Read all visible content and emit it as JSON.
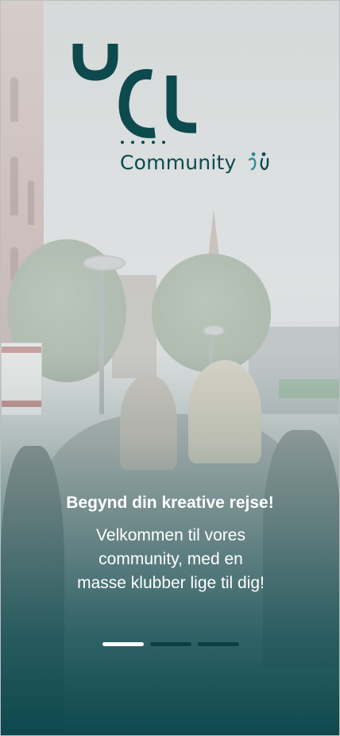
{
  "brand": {
    "logo_mark": "UCL",
    "name": "Community",
    "icon": "community-people-icon",
    "color": "#0d4a4e"
  },
  "onboarding": {
    "headline": "Begynd din kreative rejse!",
    "subtitle": "Velkommen til vores community, med en masse klubber lige til dig!",
    "pager": {
      "total": 3,
      "current": 1,
      "active_color": "#ffffff",
      "inactive_color": "#0c3f44"
    }
  },
  "background": {
    "overlay_color": "#0a464c"
  }
}
